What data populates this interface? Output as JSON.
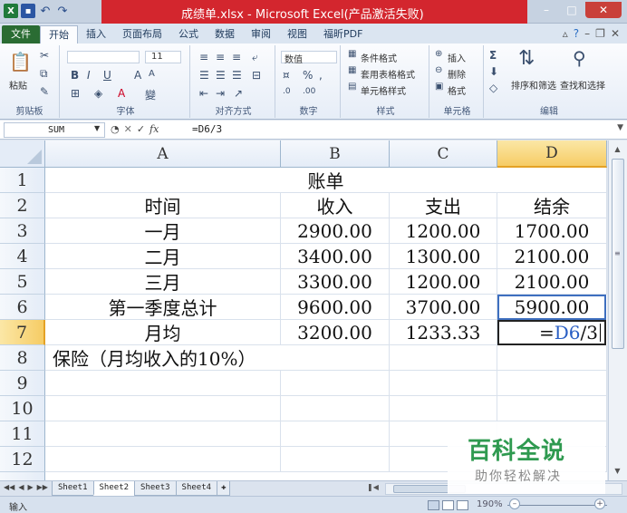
{
  "window": {
    "title": "成绩单.xlsx - Microsoft Excel(产品激活失败)"
  },
  "ribbon_tabs": [
    "文件",
    "开始",
    "插入",
    "页面布局",
    "公式",
    "数据",
    "审阅",
    "视图",
    "福昕PDF"
  ],
  "ribbon": {
    "clipboard": {
      "paste_label": "粘贴",
      "group_label": "剪贴板"
    },
    "font": {
      "font_size": "11",
      "group_label": "字体"
    },
    "alignment": {
      "group_label": "对齐方式"
    },
    "number": {
      "format_value": "数值",
      "group_label": "数字"
    },
    "styles": {
      "conditional_label": "条件格式",
      "table_label": "套用表格格式",
      "cell_styles_label": "单元格样式",
      "group_label": "样式"
    },
    "cells": {
      "insert_label": "插入",
      "delete_label": "删除",
      "format_label": "格式",
      "group_label": "单元格"
    },
    "editing": {
      "sort_label": "排序和筛选",
      "find_label": "查找和选择",
      "group_label": "编辑"
    }
  },
  "formula_bar": {
    "name_box": "SUM",
    "formula": "=D6/3"
  },
  "columns": [
    "A",
    "B",
    "C",
    "D"
  ],
  "rows": [
    "1",
    "2",
    "3",
    "4",
    "5",
    "6",
    "7",
    "8",
    "9",
    "10",
    "11",
    "12"
  ],
  "cells": {
    "title": "账单",
    "headers": [
      "时间",
      "收入",
      "支出",
      "结余"
    ],
    "data": [
      [
        "一月",
        "2900.00",
        "1200.00",
        "1700.00"
      ],
      [
        "二月",
        "3400.00",
        "1300.00",
        "2100.00"
      ],
      [
        "三月",
        "3300.00",
        "1200.00",
        "2100.00"
      ],
      [
        "第一季度总计",
        "9600.00",
        "3700.00",
        "5900.00"
      ],
      [
        "月均",
        "3200.00",
        "1233.33",
        ""
      ]
    ],
    "d7_prefix": "=",
    "d7_ref": "D6",
    "d7_suffix": "/3",
    "a8": "保险（月均收入的10%）"
  },
  "sheets": [
    "Sheet1",
    "Sheet2",
    "Sheet3",
    "Sheet4"
  ],
  "active_sheet": "Sheet2",
  "status": {
    "mode": "输入",
    "zoom": "190%"
  },
  "watermark": {
    "main": "百科全说",
    "sub": "助你轻松解决"
  }
}
